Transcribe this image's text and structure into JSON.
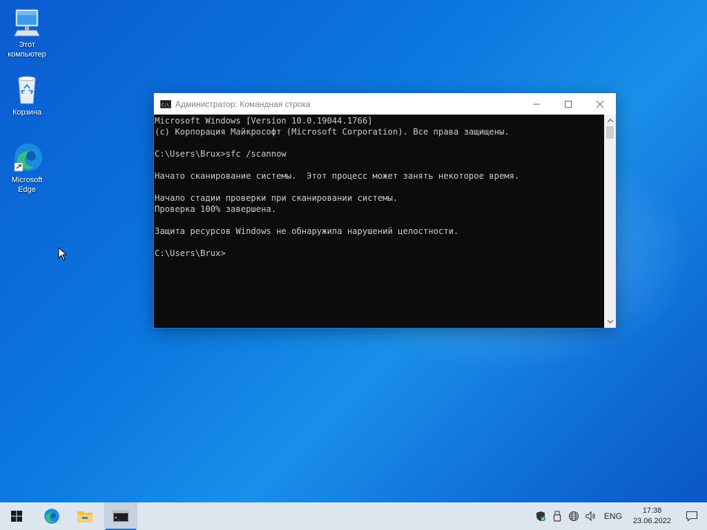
{
  "desktop": {
    "icons": [
      {
        "label": "Этот компьютер"
      },
      {
        "label": "Корзина"
      },
      {
        "label": "Microsoft Edge"
      }
    ]
  },
  "window": {
    "title": "Администратор: Командная строка",
    "console_lines": [
      "Microsoft Windows [Version 10.0.19044.1766]",
      "(c) Корпорация Майкрософт (Microsoft Corporation). Все права защищены.",
      "",
      "C:\\Users\\Brux>sfc /scannow",
      "",
      "Начато сканирование системы.  Этот процесс может занять некоторое время.",
      "",
      "Начало стадии проверки при сканировании системы.",
      "Проверка 100% завершена.",
      "",
      "Защита ресурсов Windows не обнаружила нарушений целостности.",
      "",
      "C:\\Users\\Brux>"
    ]
  },
  "taskbar": {
    "language": "ENG",
    "time": "17:38",
    "date": "23.06.2022"
  },
  "colors": {
    "console_bg": "#0c0c0c",
    "console_fg": "#cccccc",
    "taskbar_bg": "#dde6ef",
    "accent": "#2f6fc1"
  }
}
